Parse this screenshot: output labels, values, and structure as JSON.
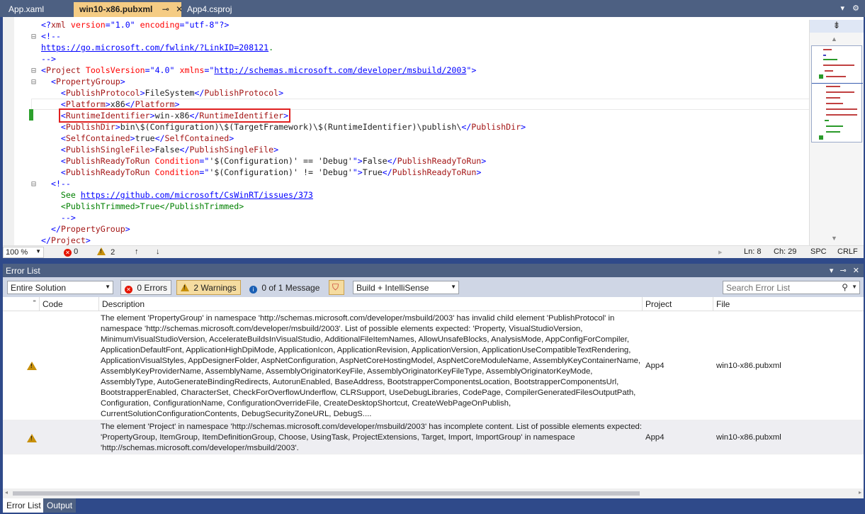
{
  "tabs": [
    {
      "label": "App.xaml",
      "active": false
    },
    {
      "label": "win10-x86.pubxml",
      "active": true
    },
    {
      "label": "App4.csproj",
      "active": false
    }
  ],
  "editor": {
    "lines": [
      {
        "fold": "",
        "indent": 0,
        "parts": [
          [
            "blue",
            "<?"
          ],
          [
            "red",
            "xml"
          ],
          [
            "attr",
            " version"
          ],
          [
            "blue",
            "="
          ],
          [
            "blue",
            "\"1.0\""
          ],
          [
            "attr",
            " encoding"
          ],
          [
            "blue",
            "="
          ],
          [
            "blue",
            "\"utf-8\""
          ],
          [
            "blue",
            "?>"
          ]
        ]
      },
      {
        "fold": "⊟",
        "indent": 0,
        "parts": [
          [
            "blue",
            "<!--"
          ]
        ]
      },
      {
        "fold": "",
        "indent": 0,
        "parts": [
          [
            "link",
            "https://go.microsoft.com/fwlink/?LinkID=208121"
          ],
          [
            "green",
            "."
          ]
        ]
      },
      {
        "fold": "",
        "indent": 0,
        "parts": [
          [
            "blue",
            "-->"
          ]
        ]
      },
      {
        "fold": "⊟",
        "indent": 0,
        "parts": [
          [
            "blue",
            "<"
          ],
          [
            "red",
            "Project"
          ],
          [
            "attr",
            " ToolsVersion"
          ],
          [
            "blue",
            "="
          ],
          [
            "blue",
            "\"4.0\""
          ],
          [
            "attr",
            " xmlns"
          ],
          [
            "blue",
            "="
          ],
          [
            "blue",
            "\""
          ],
          [
            "link",
            "http://schemas.microsoft.com/developer/msbuild/2003"
          ],
          [
            "blue",
            "\">"
          ]
        ]
      },
      {
        "fold": "⊟",
        "indent": 1,
        "parts": [
          [
            "blue",
            "<"
          ],
          [
            "red",
            "PropertyGroup"
          ],
          [
            "blue",
            ">"
          ]
        ]
      },
      {
        "fold": "",
        "indent": 2,
        "parts": [
          [
            "blue",
            "<"
          ],
          [
            "red",
            "PublishProtocol"
          ],
          [
            "blue",
            ">"
          ],
          [
            "text",
            "FileSystem"
          ],
          [
            "blue",
            "</"
          ],
          [
            "red",
            "PublishProtocol"
          ],
          [
            "blue",
            ">"
          ]
        ]
      },
      {
        "fold": "",
        "indent": 2,
        "parts": [
          [
            "blue",
            "<"
          ],
          [
            "red",
            "Platform"
          ],
          [
            "blue",
            ">"
          ],
          [
            "text",
            "x86"
          ],
          [
            "blue",
            "</"
          ],
          [
            "red",
            "Platform"
          ],
          [
            "blue",
            ">"
          ]
        ]
      },
      {
        "fold": "",
        "indent": 2,
        "highlight": true,
        "parts": [
          [
            "blue",
            "<"
          ],
          [
            "red",
            "RuntimeIdentifier"
          ],
          [
            "blue",
            ">"
          ],
          [
            "text",
            "win-x86"
          ],
          [
            "blue",
            "</"
          ],
          [
            "red",
            "RuntimeIdentifier"
          ],
          [
            "blue",
            ">"
          ]
        ]
      },
      {
        "fold": "",
        "indent": 2,
        "parts": [
          [
            "blue",
            "<"
          ],
          [
            "red",
            "PublishDir"
          ],
          [
            "blue",
            ">"
          ],
          [
            "text",
            "bin\\$(Configuration)\\$(TargetFramework)\\$(RuntimeIdentifier)\\publish\\"
          ],
          [
            "blue",
            "</"
          ],
          [
            "red",
            "PublishDir"
          ],
          [
            "blue",
            ">"
          ]
        ]
      },
      {
        "fold": "",
        "indent": 2,
        "parts": [
          [
            "blue",
            "<"
          ],
          [
            "red",
            "SelfContained"
          ],
          [
            "blue",
            ">"
          ],
          [
            "text",
            "true"
          ],
          [
            "blue",
            "</"
          ],
          [
            "red",
            "SelfContained"
          ],
          [
            "blue",
            ">"
          ]
        ]
      },
      {
        "fold": "",
        "indent": 2,
        "parts": [
          [
            "blue",
            "<"
          ],
          [
            "red",
            "PublishSingleFile"
          ],
          [
            "blue",
            ">"
          ],
          [
            "text",
            "False"
          ],
          [
            "blue",
            "</"
          ],
          [
            "red",
            "PublishSingleFile"
          ],
          [
            "blue",
            ">"
          ]
        ]
      },
      {
        "fold": "",
        "indent": 2,
        "parts": [
          [
            "blue",
            "<"
          ],
          [
            "red",
            "PublishReadyToRun"
          ],
          [
            "attr",
            " Condition"
          ],
          [
            "blue",
            "="
          ],
          [
            "blue",
            "\""
          ],
          [
            "text",
            "'$(Configuration)' == 'Debug'"
          ],
          [
            "blue",
            "\">"
          ],
          [
            "text",
            "False"
          ],
          [
            "blue",
            "</"
          ],
          [
            "red",
            "PublishReadyToRun"
          ],
          [
            "blue",
            ">"
          ]
        ]
      },
      {
        "fold": "",
        "indent": 2,
        "parts": [
          [
            "blue",
            "<"
          ],
          [
            "red",
            "PublishReadyToRun"
          ],
          [
            "attr",
            " Condition"
          ],
          [
            "blue",
            "="
          ],
          [
            "blue",
            "\""
          ],
          [
            "text",
            "'$(Configuration)' != 'Debug'"
          ],
          [
            "blue",
            "\">"
          ],
          [
            "text",
            "True"
          ],
          [
            "blue",
            "</"
          ],
          [
            "red",
            "PublishReadyToRun"
          ],
          [
            "blue",
            ">"
          ]
        ]
      },
      {
        "fold": "⊟",
        "indent": 1,
        "parts": [
          [
            "blue",
            "<!--"
          ]
        ]
      },
      {
        "fold": "",
        "indent": 2,
        "parts": [
          [
            "green",
            "See "
          ],
          [
            "link",
            "https://github.com/microsoft/CsWinRT/issues/373"
          ]
        ]
      },
      {
        "fold": "",
        "indent": 2,
        "parts": [
          [
            "green",
            "<PublishTrimmed>True</PublishTrimmed>"
          ]
        ]
      },
      {
        "fold": "",
        "indent": 2,
        "parts": [
          [
            "blue",
            "-->"
          ]
        ]
      },
      {
        "fold": "",
        "indent": 1,
        "parts": [
          [
            "blue",
            "</"
          ],
          [
            "red",
            "PropertyGroup"
          ],
          [
            "blue",
            ">"
          ]
        ]
      },
      {
        "fold": "",
        "indent": 0,
        "parts": [
          [
            "blue",
            "</"
          ],
          [
            "red",
            "Project"
          ],
          [
            "blue",
            ">"
          ]
        ]
      }
    ]
  },
  "editor_status": {
    "zoom": "100 %",
    "errors": "0",
    "warnings": "2",
    "ln": "Ln: 8",
    "ch": "Ch: 29",
    "spc": "SPC",
    "crlf": "CRLF"
  },
  "error_list": {
    "title": "Error List",
    "scope": "Entire Solution",
    "errors_btn": "0 Errors",
    "warnings_btn": "2 Warnings",
    "messages_btn": "0 of 1 Message",
    "build_filter": "Build + IntelliSense",
    "search_placeholder": "Search Error List",
    "columns": {
      "code": "Code",
      "description": "Description",
      "project": "Project",
      "file": "File"
    },
    "rows": [
      {
        "severity": "warning",
        "description": "The element 'PropertyGroup' in namespace 'http://schemas.microsoft.com/developer/msbuild/2003' has invalid child element 'PublishProtocol' in namespace 'http://schemas.microsoft.com/developer/msbuild/2003'. List of possible elements expected: 'Property, VisualStudioVersion, MinimumVisualStudioVersion, AccelerateBuildsInVisualStudio, AdditionalFileItemNames, AllowUnsafeBlocks, AnalysisMode, AppConfigForCompiler, ApplicationDefaultFont, ApplicationHighDpiMode, ApplicationIcon, ApplicationRevision, ApplicationVersion, ApplicationUseCompatibleTextRendering, ApplicationVisualStyles, AppDesignerFolder, AspNetConfiguration, AspNetCoreHostingModel, AspNetCoreModuleName, AssemblyKeyContainerName, AssemblyKeyProviderName, AssemblyName, AssemblyOriginatorKeyFile, AssemblyOriginatorKeyFileType, AssemblyOriginatorKeyMode, AssemblyType, AutoGenerateBindingRedirects, AutorunEnabled, BaseAddress, BootstrapperComponentsLocation, BootstrapperComponentsUrl, BootstrapperEnabled, CharacterSet, CheckForOverflowUnderflow, CLRSupport, UseDebugLibraries, CodePage, CompilerGeneratedFilesOutputPath, Configuration, ConfigurationName, ConfigurationOverrideFile, CreateDesktopShortcut, CreateWebPageOnPublish, CurrentSolutionConfigurationContents, DebugSecurityZoneURL, DebugS....",
        "project": "App4",
        "file": "win10-x86.pubxml"
      },
      {
        "severity": "warning",
        "description": "The element 'Project' in namespace 'http://schemas.microsoft.com/developer/msbuild/2003' has incomplete content. List of possible elements expected: 'PropertyGroup, ItemGroup, ItemDefinitionGroup, Choose, UsingTask, ProjectExtensions, Target, Import, ImportGroup' in namespace 'http://schemas.microsoft.com/developer/msbuild/2003'.",
        "project": "App4",
        "file": "win10-x86.pubxml"
      }
    ]
  },
  "bottom_tabs": [
    {
      "label": "Error List",
      "active": true
    },
    {
      "label": "Output",
      "active": false
    }
  ]
}
